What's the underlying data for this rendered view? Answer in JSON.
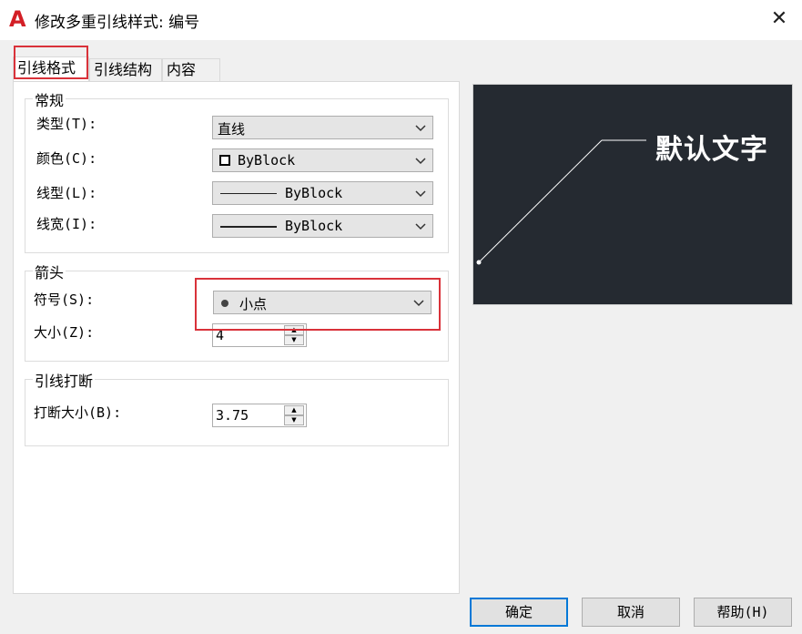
{
  "window": {
    "title": "修改多重引线样式: 编号",
    "app_icon": "autocad-icon",
    "close_glyph": "✕"
  },
  "tabs": [
    {
      "label": "引线格式",
      "active": true
    },
    {
      "label": "引线结构",
      "active": false
    },
    {
      "label": "内容",
      "active": false
    }
  ],
  "general": {
    "title": "常规",
    "type_label": "类型(T):",
    "type_value": "直线",
    "color_label": "颜色(C):",
    "color_value": "ByBlock",
    "linetype_label": "线型(L):",
    "linetype_value": "ByBlock",
    "lineweight_label": "线宽(I):",
    "lineweight_value": "ByBlock"
  },
  "arrowhead": {
    "title": "箭头",
    "symbol_label": "符号(S):",
    "symbol_value": "小点",
    "size_label": "大小(Z):",
    "size_value": "4"
  },
  "leader_break": {
    "title": "引线打断",
    "break_size_label": "打断大小(B):",
    "break_size_value": "3.75"
  },
  "preview": {
    "text": "默认文字",
    "background": "#252a31",
    "line_color": "#ffffff"
  },
  "buttons": {
    "ok": "确定",
    "cancel": "取消",
    "help": "帮助(H)"
  },
  "colors": {
    "highlight_red": "#d9323a",
    "primary_border": "#0078d7"
  }
}
